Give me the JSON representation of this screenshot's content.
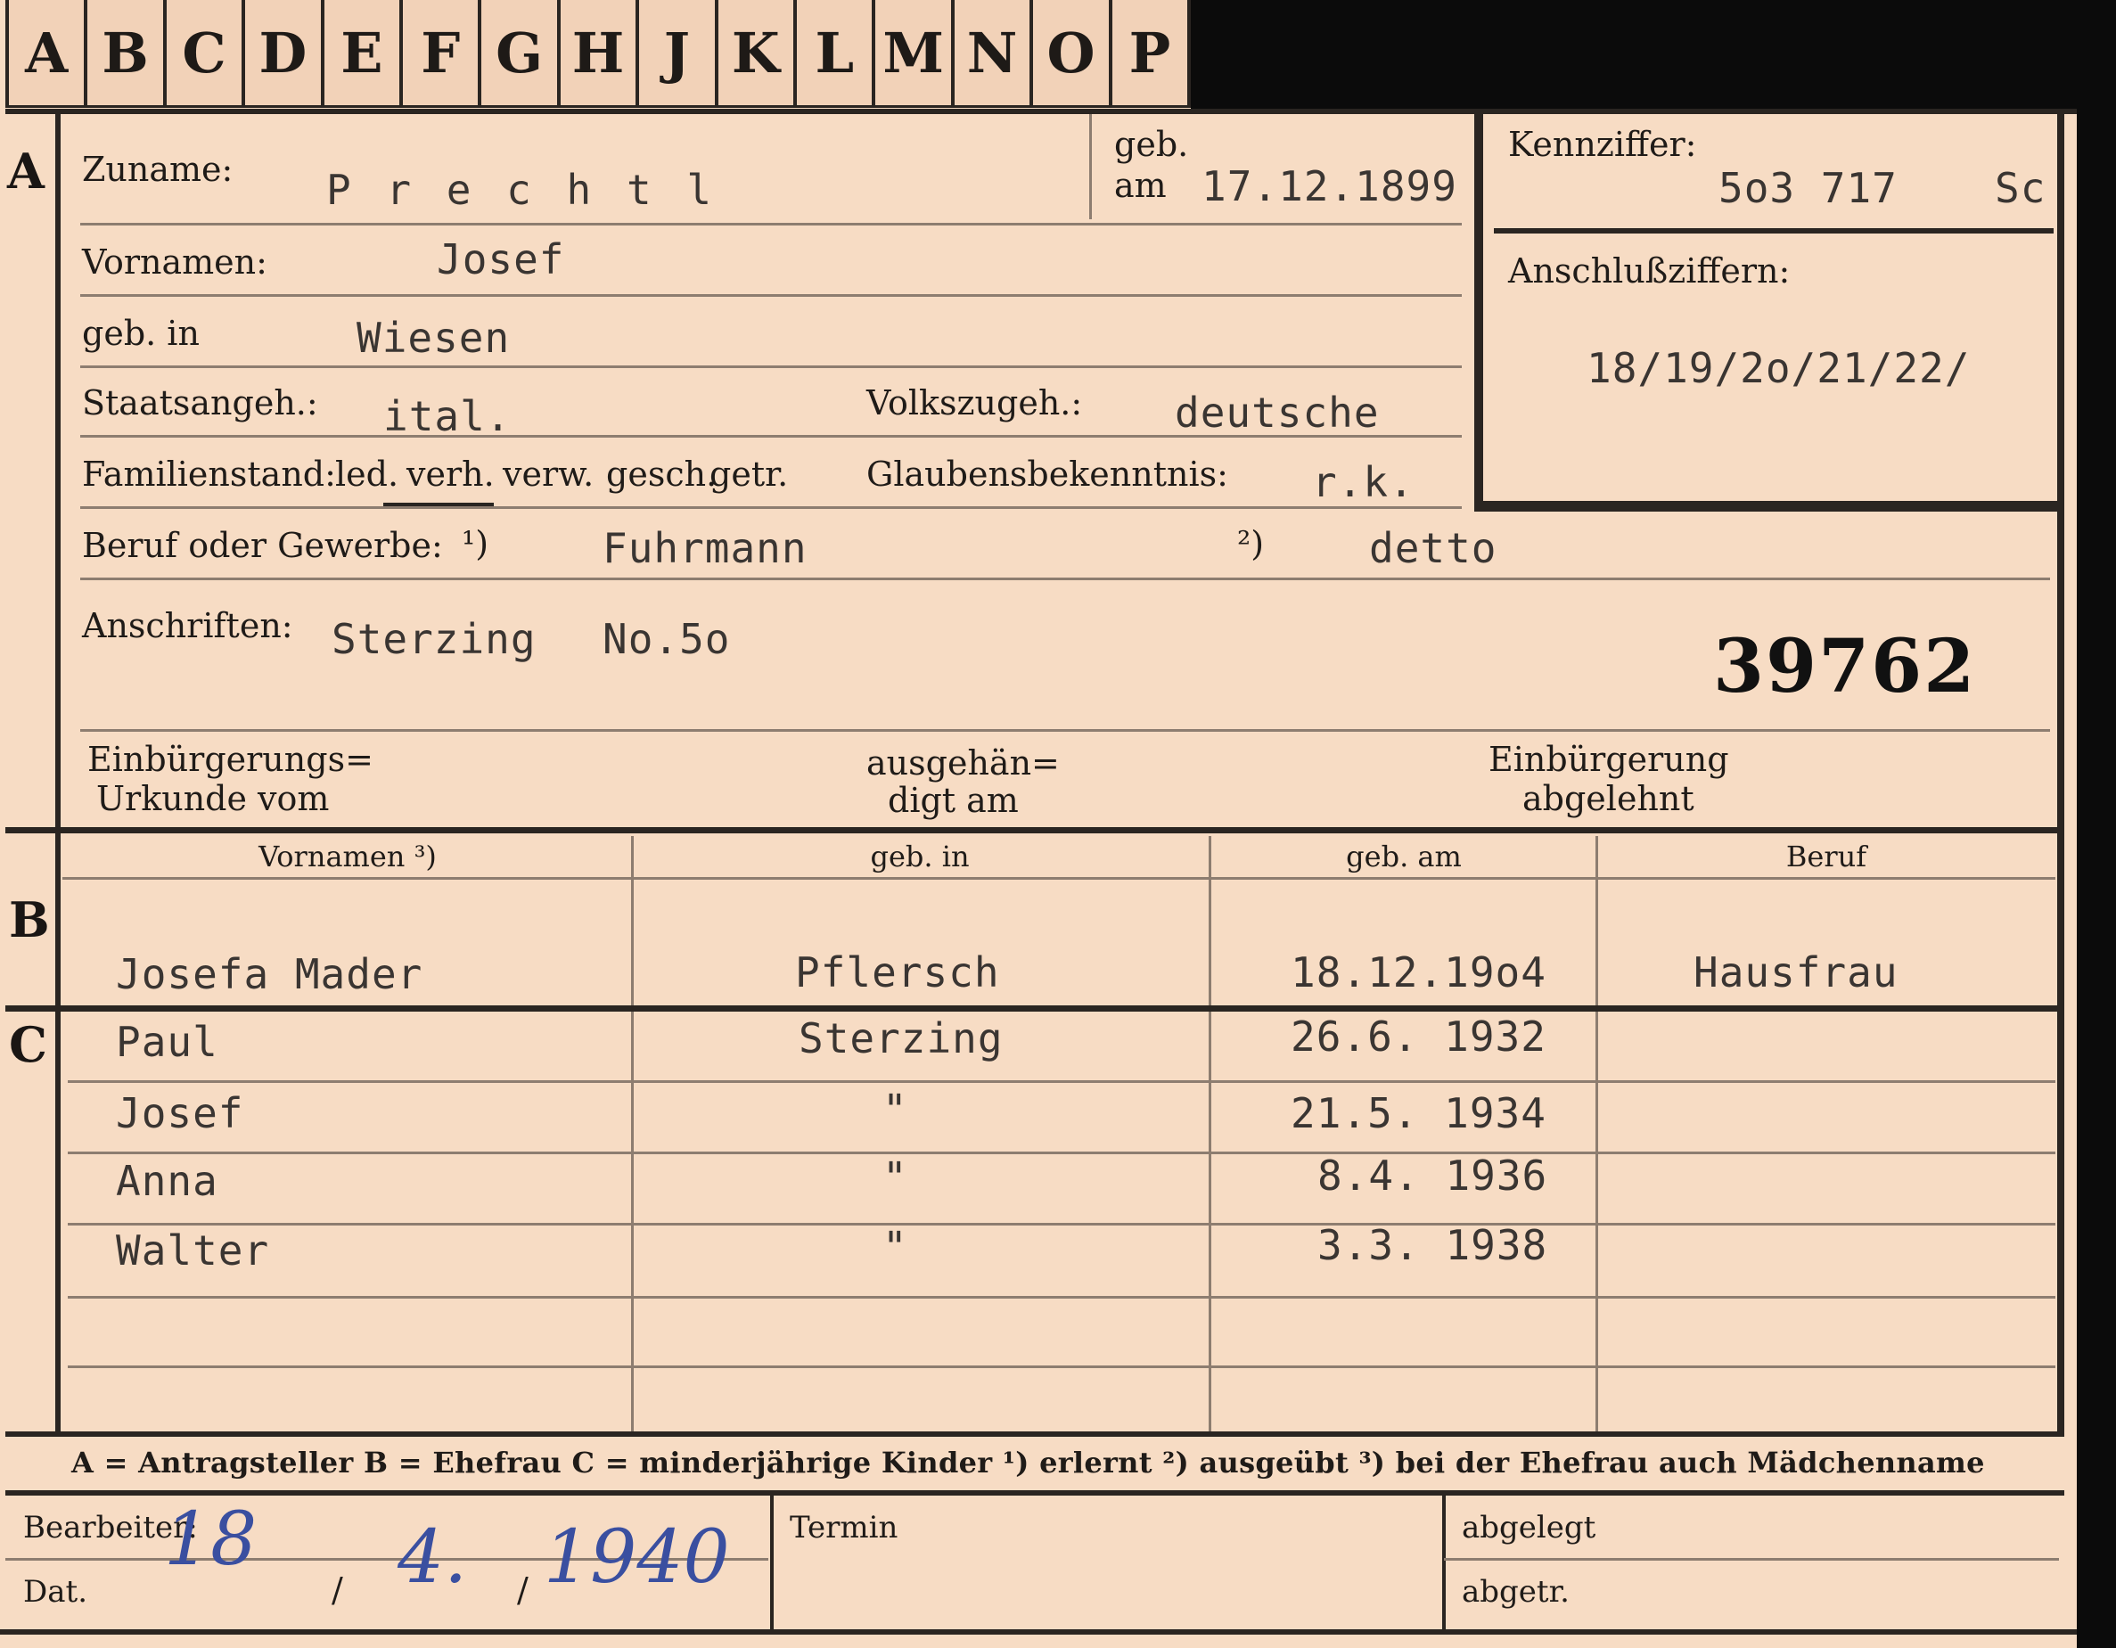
{
  "index_tabs": [
    "A",
    "B",
    "C",
    "D",
    "E",
    "F",
    "G",
    "H",
    "J",
    "K",
    "L",
    "M",
    "N",
    "O",
    "P"
  ],
  "section_a": {
    "letter": "A",
    "surname_label": "Zuname:",
    "surname": "P r e c h t l",
    "born_label_line1": "geb.",
    "born_label_line2": "am",
    "birth_date": "17.12.1899",
    "id_label": "Kennziffer:",
    "id_number": "5o3 717",
    "id_suffix": "Sc",
    "attach_label": "Anschlußziffern:",
    "attach_numbers": "18/19/2o/21/22/",
    "first_names_label": "Vornamen:",
    "first_names": "Josef",
    "birthplace_label": "geb. in",
    "birthplace": "Wiesen",
    "citizenship_label": "Staatsangeh.:",
    "citizenship": "ital.",
    "ethnicity_label": "Volkszugeh.:",
    "ethnicity": "deutsche",
    "marital_label": "Familienstand:",
    "marital_options": [
      "led.",
      "verh.",
      "verw.",
      "gesch.",
      "getr."
    ],
    "marital_selected": "verh.",
    "religion_label": "Glaubensbekenntnis:",
    "religion": "r.k.",
    "occupation_label": "Beruf oder Gewerbe:",
    "note1_mark": "¹)",
    "occupation_learned": "Fuhrmann",
    "note2_mark": "²)",
    "occupation_practiced": "detto",
    "address_label": "Anschriften:",
    "address": "Sterzing",
    "address_number": "No.5o",
    "stamp_number": "39762",
    "naturalization_label_line1": "Einbürgerungs=",
    "naturalization_label_line2": "Urkunde vom",
    "handed_label_line1": "ausgehän=",
    "handed_label_line2": "digt am",
    "refused_label_line1": "Einbürgerung",
    "refused_label_line2": "abgelehnt"
  },
  "section_b": {
    "letter": "B",
    "headers": [
      "Vornamen ³)",
      "geb. in",
      "geb. am",
      "Beruf"
    ],
    "row": [
      "Josefa  Mader",
      "Pflersch",
      "18.12.19o4",
      "Hausfrau"
    ]
  },
  "section_c": {
    "letter": "C",
    "rows": [
      [
        "Paul",
        "Sterzing",
        "26.6. 1932",
        ""
      ],
      [
        "Josef",
        "\"",
        "21.5. 1934",
        ""
      ],
      [
        "Anna",
        "\"",
        "8.4. 1936",
        ""
      ],
      [
        "Walter",
        "\"",
        "3.3. 1938",
        ""
      ]
    ]
  },
  "legend": "A = Antragsteller   B = Ehefrau   C = minderjährige Kinder   ¹) erlernt   ²) ausgeübt   ³) bei der Ehefrau auch Mädchenname",
  "footer": {
    "clerk_label": "Bearbeiter:",
    "date_label": "Dat.",
    "date_day": "18",
    "date_month": "4.",
    "date_year": "1940",
    "date_sep": "/",
    "deadline_label": "Termin",
    "filed_label": "abgelegt",
    "detached_label": "abgetr."
  }
}
